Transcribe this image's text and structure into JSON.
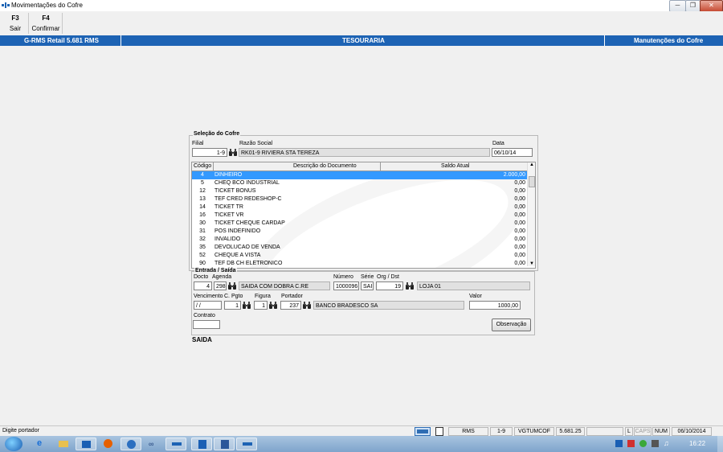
{
  "window": {
    "title": "Movimentações do Cofre",
    "controls": [
      "minimize-icon",
      "maximize-icon",
      "close-icon"
    ]
  },
  "toolbar": {
    "f3_key": "F3",
    "f3_label": "Sair",
    "f4_key": "F4",
    "f4_label": "Confirmar"
  },
  "header": {
    "left": "G-RMS Retail 5.681 RMS",
    "center": "TESOURARIA",
    "right": "Manutenções do Cofre"
  },
  "selecao": {
    "group_title": "Seleção do Cofre",
    "filial_label": "Filial",
    "filial_value": "1-9",
    "razao_label": "Razão Social",
    "razao_value": "RK01-9 RIVIERA STA TEREZA",
    "data_label": "Data",
    "data_value": "06/10/14"
  },
  "grid": {
    "headers": {
      "codigo": "Código",
      "descricao": "Descrição do Documento",
      "saldo": "Saldo Atual"
    },
    "rows": [
      {
        "codigo": "4",
        "descricao": "DINHEIRO",
        "saldo": "2.000,00",
        "selected": true
      },
      {
        "codigo": "5",
        "descricao": "CHEQ BCO INDUSTRIAL",
        "saldo": "0,00"
      },
      {
        "codigo": "12",
        "descricao": "TICKET BONUS",
        "saldo": "0,00"
      },
      {
        "codigo": "13",
        "descricao": "TEF CRED REDESHOP-C",
        "saldo": "0,00"
      },
      {
        "codigo": "14",
        "descricao": "TICKET TR",
        "saldo": "0,00"
      },
      {
        "codigo": "16",
        "descricao": "TICKET VR",
        "saldo": "0,00"
      },
      {
        "codigo": "30",
        "descricao": "TICKET CHEQUE CARDAP",
        "saldo": "0,00"
      },
      {
        "codigo": "31",
        "descricao": "POS INDEFINIDO",
        "saldo": "0,00"
      },
      {
        "codigo": "32",
        "descricao": "INVALIDO",
        "saldo": "0,00"
      },
      {
        "codigo": "35",
        "descricao": "DEVOLUCAO DE VENDA",
        "saldo": "0,00"
      },
      {
        "codigo": "52",
        "descricao": "CHEQUE A VISTA",
        "saldo": "0,00"
      },
      {
        "codigo": "90",
        "descricao": "TEF DB CH ELETRONICO",
        "saldo": "0,00"
      }
    ]
  },
  "entrada": {
    "group_title": "Entrada / Saída",
    "docto_label": "Docto",
    "docto_value": "4",
    "agenda_label": "Agenda",
    "agenda_value": "298",
    "agenda_desc": "SAIDA COM DOBRA C.RE",
    "numero_label": "Número",
    "numero_value": "1000096",
    "serie_label": "Série",
    "serie_value": "SAI",
    "org_label": "Org / Dst",
    "org_value": "19",
    "org_desc": "LOJA 01",
    "venc_label": "Vencimento",
    "venc_value": "/ /",
    "cpgto_label": "C. Pgto",
    "cpgto_value": "1",
    "figura_label": "Figura",
    "figura_value": "1",
    "portador_label": "Portador",
    "portador_value": "237",
    "portador_desc": "BANCO BRADESCO SA",
    "valor_label": "Valor",
    "valor_value": "1000,00",
    "contrato_label": "Contrato",
    "contrato_value": "",
    "obs_button": "Observação"
  },
  "mode_label": "SAIDA",
  "statusbar": {
    "message": "Digite portador",
    "app": "RMS",
    "filial": "1-9",
    "program": "VGTUMCOF",
    "version": "5.681.25",
    "lock": "L",
    "caps": "CAPS",
    "num": "NUM",
    "date": "06/10/2014"
  },
  "taskbar": {
    "clock": "16:22"
  }
}
